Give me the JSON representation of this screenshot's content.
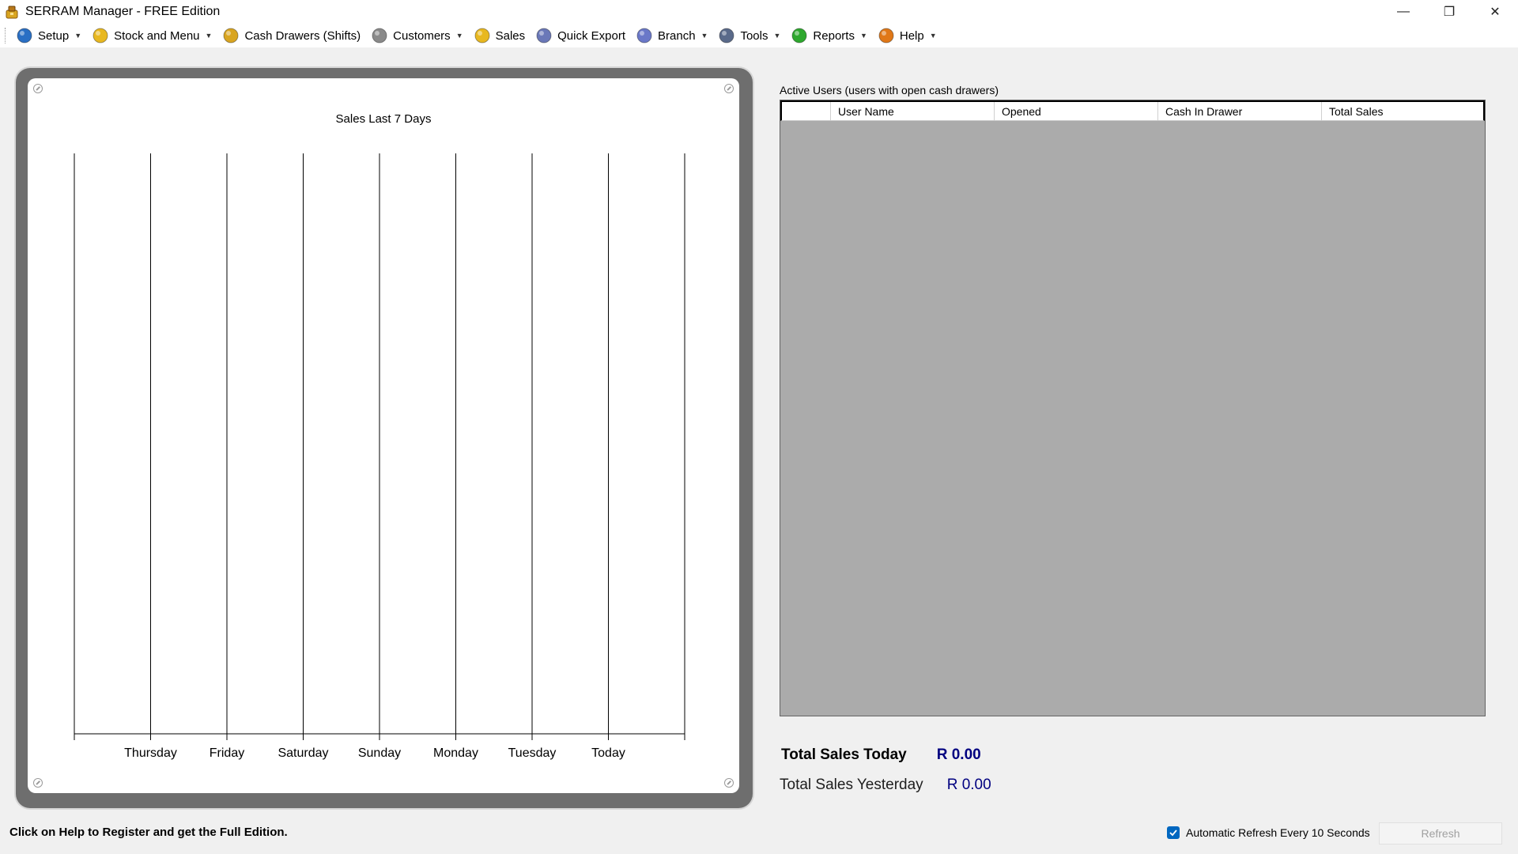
{
  "window": {
    "title": "SERRAM Manager - FREE Edition",
    "minimize_glyph": "—",
    "maximize_glyph": "❐",
    "close_glyph": "✕"
  },
  "menu": {
    "items": [
      {
        "label": "Setup",
        "icon": "globe-setup-icon",
        "dropdown": true,
        "color": "#2a6fc4"
      },
      {
        "label": "Stock and Menu",
        "icon": "stock-box-icon",
        "dropdown": true,
        "color": "#e8b820"
      },
      {
        "label": "Cash Drawers (Shifts)",
        "icon": "cash-drawer-icon",
        "dropdown": false,
        "color": "#d9a520"
      },
      {
        "label": "Customers",
        "icon": "customers-icon",
        "dropdown": true,
        "color": "#8a8a8a"
      },
      {
        "label": "Sales",
        "icon": "sales-coin-icon",
        "dropdown": false,
        "color": "#e8b820"
      },
      {
        "label": "Quick Export",
        "icon": "quick-export-icon",
        "dropdown": false,
        "color": "#6a78b8"
      },
      {
        "label": "Branch",
        "icon": "branch-icon",
        "dropdown": true,
        "color": "#6a78c8"
      },
      {
        "label": "Tools",
        "icon": "tools-icon",
        "dropdown": true,
        "color": "#5a6a8a"
      },
      {
        "label": "Reports",
        "icon": "reports-icon",
        "dropdown": true,
        "color": "#2ea82e"
      },
      {
        "label": "Help",
        "icon": "help-icon",
        "dropdown": true,
        "color": "#e07818"
      }
    ]
  },
  "chart_data": {
    "type": "bar",
    "title": "Sales Last 7 Days",
    "categories": [
      "Thursday",
      "Friday",
      "Saturday",
      "Sunday",
      "Monday",
      "Tuesday",
      "Today"
    ],
    "values": [
      0,
      0,
      0,
      0,
      0,
      0,
      0
    ],
    "grid": true,
    "legend": "none"
  },
  "active_users": {
    "caption": "Active Users (users with open cash drawers)",
    "columns": [
      "",
      "User Name",
      "Opened",
      "Cash In Drawer",
      "Total Sales"
    ],
    "rows": []
  },
  "totals": {
    "today_label": "Total Sales Today",
    "today_value": "R 0.00",
    "yesterday_label": "Total Sales Yesterday",
    "yesterday_value": "R 0.00"
  },
  "footer": {
    "status_message": "Click on Help to Register and get the Full Edition.",
    "auto_refresh_label": "Automatic Refresh Every 10 Seconds",
    "auto_refresh_checked": true,
    "refresh_label": "Refresh"
  }
}
